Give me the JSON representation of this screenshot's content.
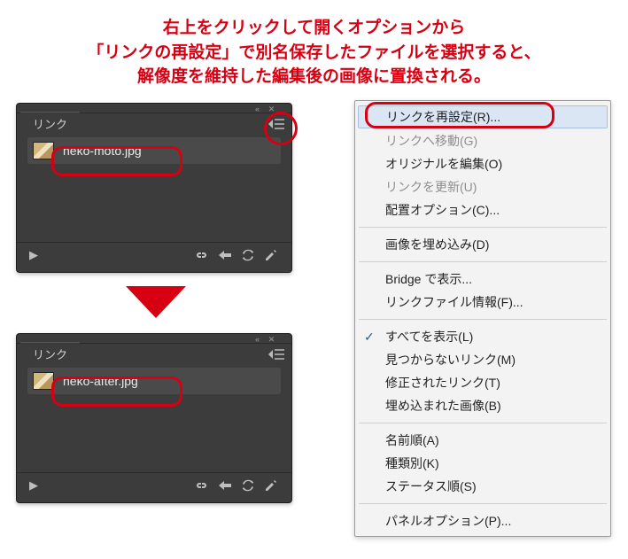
{
  "caption": {
    "line1": "右上をクリックして開くオプションから",
    "line2": "「リンクの再設定」で別名保存したファイルを選択すると、",
    "line3": "解像度を維持した編集後の画像に置換される。"
  },
  "panel": {
    "tab": "リンク",
    "before_file": "neko-moto.jpg",
    "after_file": "neko-after.jpg",
    "nav_glyph": "▶"
  },
  "menu": {
    "relink": "リンクを再設定(R)...",
    "goto": "リンクへ移動(G)",
    "edit_original": "オリジナルを編集(O)",
    "update": "リンクを更新(U)",
    "place_opts": "配置オプション(C)...",
    "embed": "画像を埋め込み(D)",
    "bridge": "Bridge で表示...",
    "file_info": "リンクファイル情報(F)...",
    "show_all": "すべてを表示(L)",
    "missing": "見つからないリンク(M)",
    "modified": "修正されたリンク(T)",
    "embedded": "埋め込まれた画像(B)",
    "sort_name": "名前順(A)",
    "sort_kind": "種類別(K)",
    "sort_status": "ステータス順(S)",
    "panel_opts": "パネルオプション(P)..."
  }
}
